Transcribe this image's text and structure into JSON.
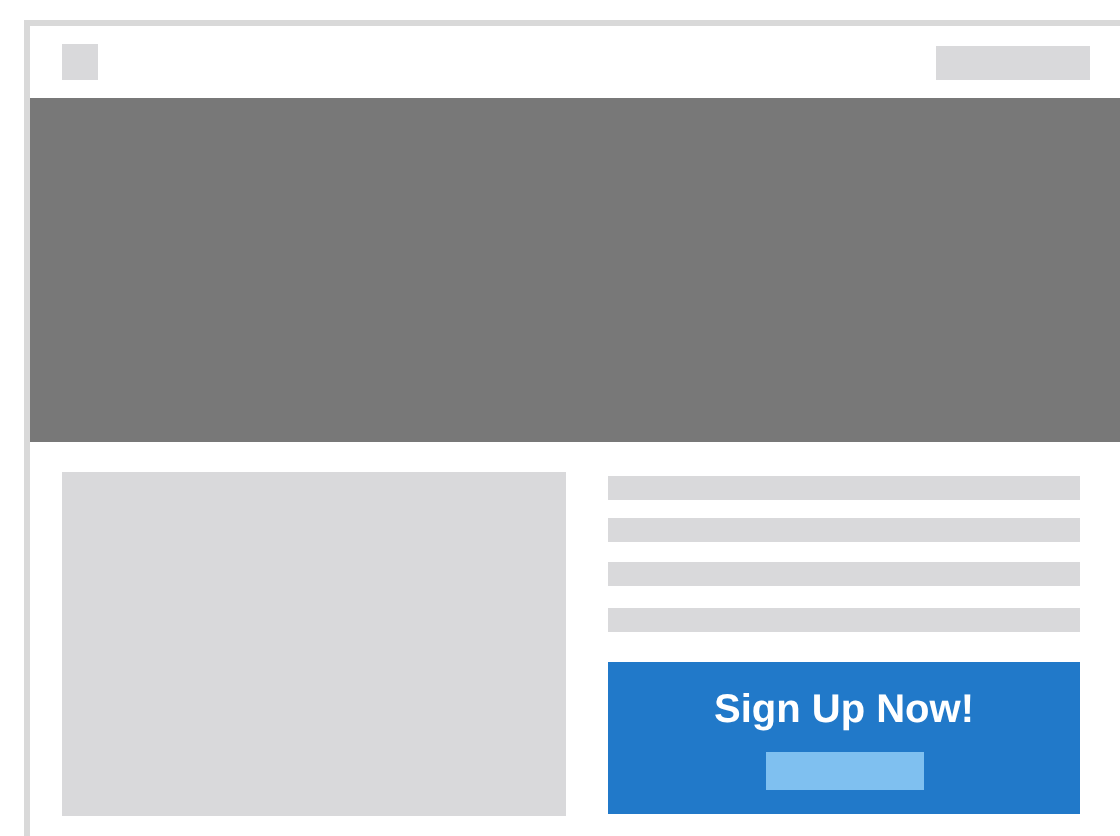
{
  "signup_card": {
    "title": "Sign Up Now!"
  }
}
